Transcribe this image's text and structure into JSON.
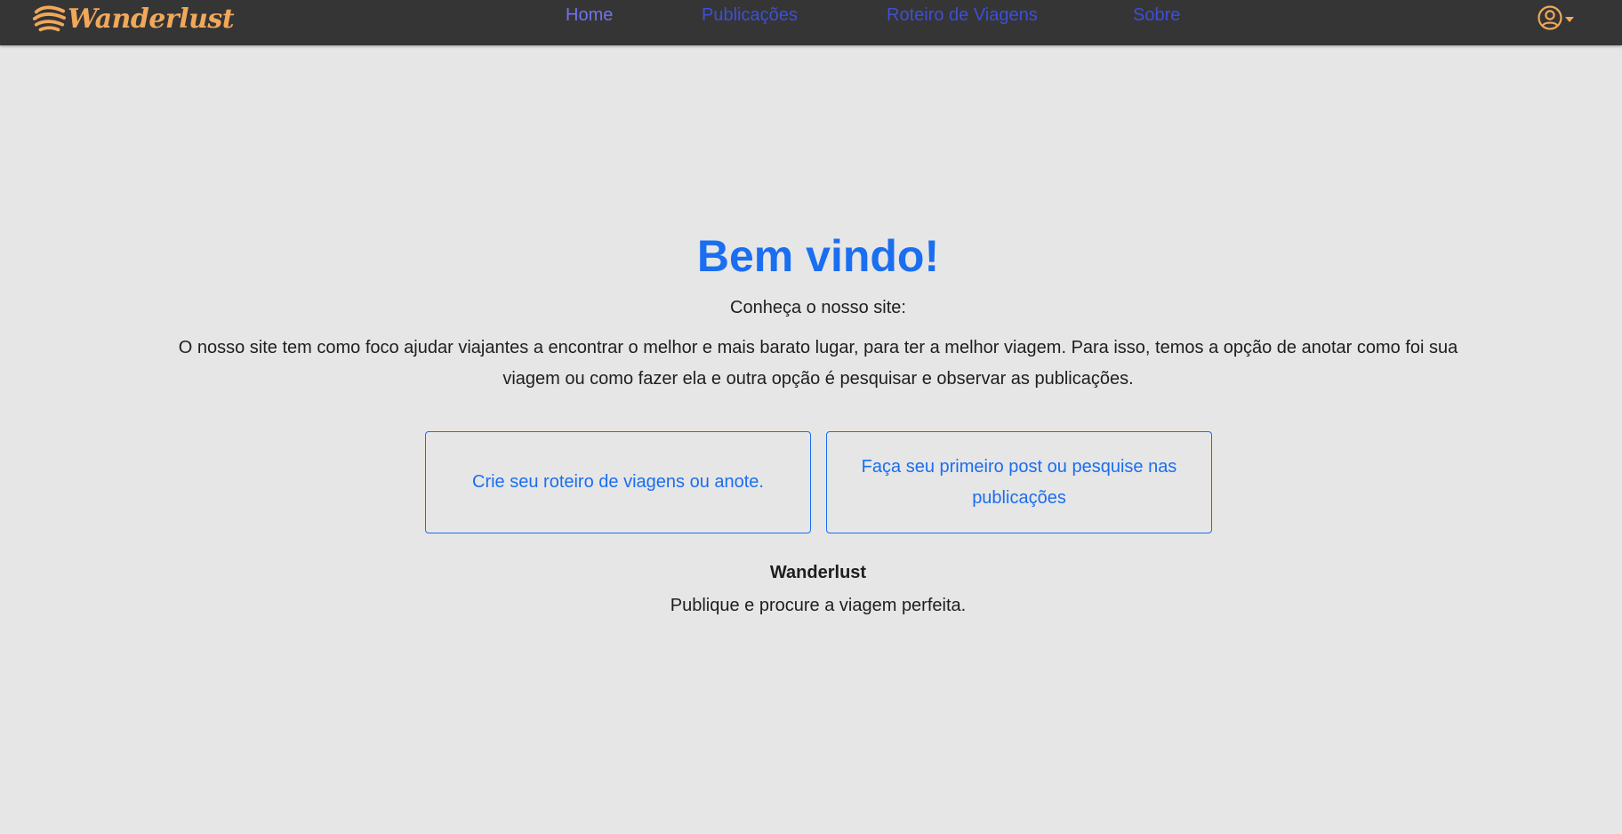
{
  "colors": {
    "accent_blue": "#1a6ef0",
    "nav_link": "#3d4fd6",
    "nav_active": "#6f72ef",
    "brand_orange": "#f1a85a",
    "navbar_bg": "#353535",
    "page_bg": "#e6e6e6"
  },
  "navbar": {
    "logo": {
      "icon": "waves-logo-icon",
      "text": "Wanderlust"
    },
    "links": [
      {
        "label": "Home",
        "active": true
      },
      {
        "label": "Publicações",
        "active": false
      },
      {
        "label": "Roteiro de Viagens",
        "active": false
      },
      {
        "label": "Sobre",
        "active": false
      }
    ],
    "user_menu": {
      "icon": "user-circle-icon",
      "caret": "caret-down-icon"
    }
  },
  "main": {
    "title": "Bem vindo!",
    "subtitle": "Conheça o nosso site:",
    "description": "O nosso site tem como foco ajudar viajantes a encontrar o melhor e mais barato lugar, para ter a melhor viagem. Para isso, temos a opção de anotar como foi sua viagem ou como fazer ela e outra opção é pesquisar e observar as publicações.",
    "cards": [
      {
        "label": "Crie seu roteiro de viagens ou anote."
      },
      {
        "label": "Faça seu primeiro post ou pesquise nas publicações"
      }
    ],
    "brand_name": "Wanderlust",
    "tagline": "Publique e procure a viagem perfeita."
  }
}
